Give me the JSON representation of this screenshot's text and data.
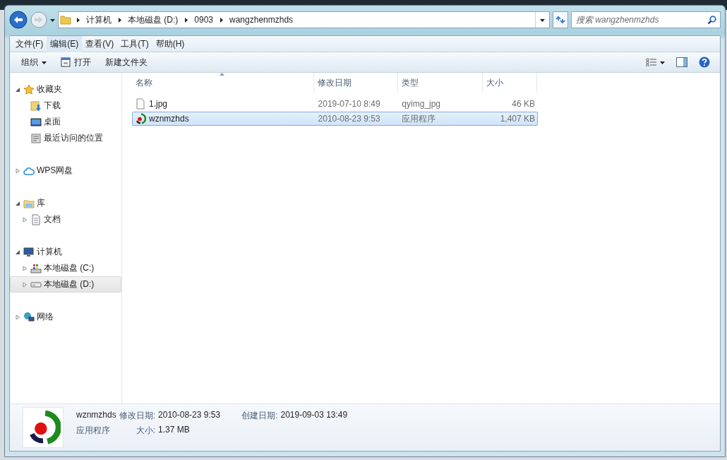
{
  "address_bar": {
    "breadcrumbs": [
      "计算机",
      "本地磁盘 (D:)",
      "0903",
      "wangzhenmzhds"
    ]
  },
  "search": {
    "placeholder": "搜索 wangzhenmzhds"
  },
  "menu_bar": [
    {
      "label": "文件(F)",
      "selected": false
    },
    {
      "label": "编辑(E)",
      "selected": true
    },
    {
      "label": "查看(V)",
      "selected": false
    },
    {
      "label": "工具(T)",
      "selected": false
    },
    {
      "label": "帮助(H)",
      "selected": false
    }
  ],
  "toolbar": {
    "organize": "组织",
    "open": "打开",
    "new_folder": "新建文件夹"
  },
  "sidebar": {
    "items": [
      {
        "label": "收藏夹",
        "kind": "star",
        "expanded": true,
        "selected": false,
        "children": [
          {
            "label": "下载",
            "kind": "download",
            "selected": false
          },
          {
            "label": "桌面",
            "kind": "desktop",
            "selected": false
          },
          {
            "label": "最近访问的位置",
            "kind": "recent",
            "selected": false
          }
        ]
      },
      {
        "label": "WPS网盘",
        "kind": "cloud",
        "expanded": false,
        "selected": false
      },
      {
        "label": "库",
        "kind": "library",
        "expanded": true,
        "selected": false,
        "children": [
          {
            "label": "文档",
            "kind": "document",
            "expanded": false,
            "selected": false
          }
        ]
      },
      {
        "label": "计算机",
        "kind": "computer",
        "expanded": true,
        "selected": false,
        "children": [
          {
            "label": "本地磁盘 (C:)",
            "kind": "system-drive",
            "expanded": false,
            "selected": false
          },
          {
            "label": "本地磁盘 (D:)",
            "kind": "drive",
            "expanded": false,
            "selected": true
          }
        ]
      },
      {
        "label": "网络",
        "kind": "network",
        "expanded": false,
        "selected": false
      }
    ]
  },
  "file_list": {
    "columns": [
      "名称",
      "修改日期",
      "类型",
      "大小"
    ],
    "rows": [
      {
        "kind": "file",
        "name": "1.jpg",
        "modified": "2019-07-10 8:49",
        "type": "qyimg_jpg",
        "size": "46 KB",
        "selected": false
      },
      {
        "kind": "app",
        "name": "wznmzhds",
        "modified": "2010-08-23 9:53",
        "type": "应用程序",
        "size": "1,407 KB",
        "selected": true
      }
    ]
  },
  "details_pane": {
    "name": "wznmzhds",
    "type": "应用程序",
    "modified_label": "修改日期:",
    "modified": "2010-08-23 9:53",
    "size_label": "大小:",
    "size": "1.37 MB",
    "created_label": "创建日期:",
    "created": "2019-09-03 13:49"
  }
}
